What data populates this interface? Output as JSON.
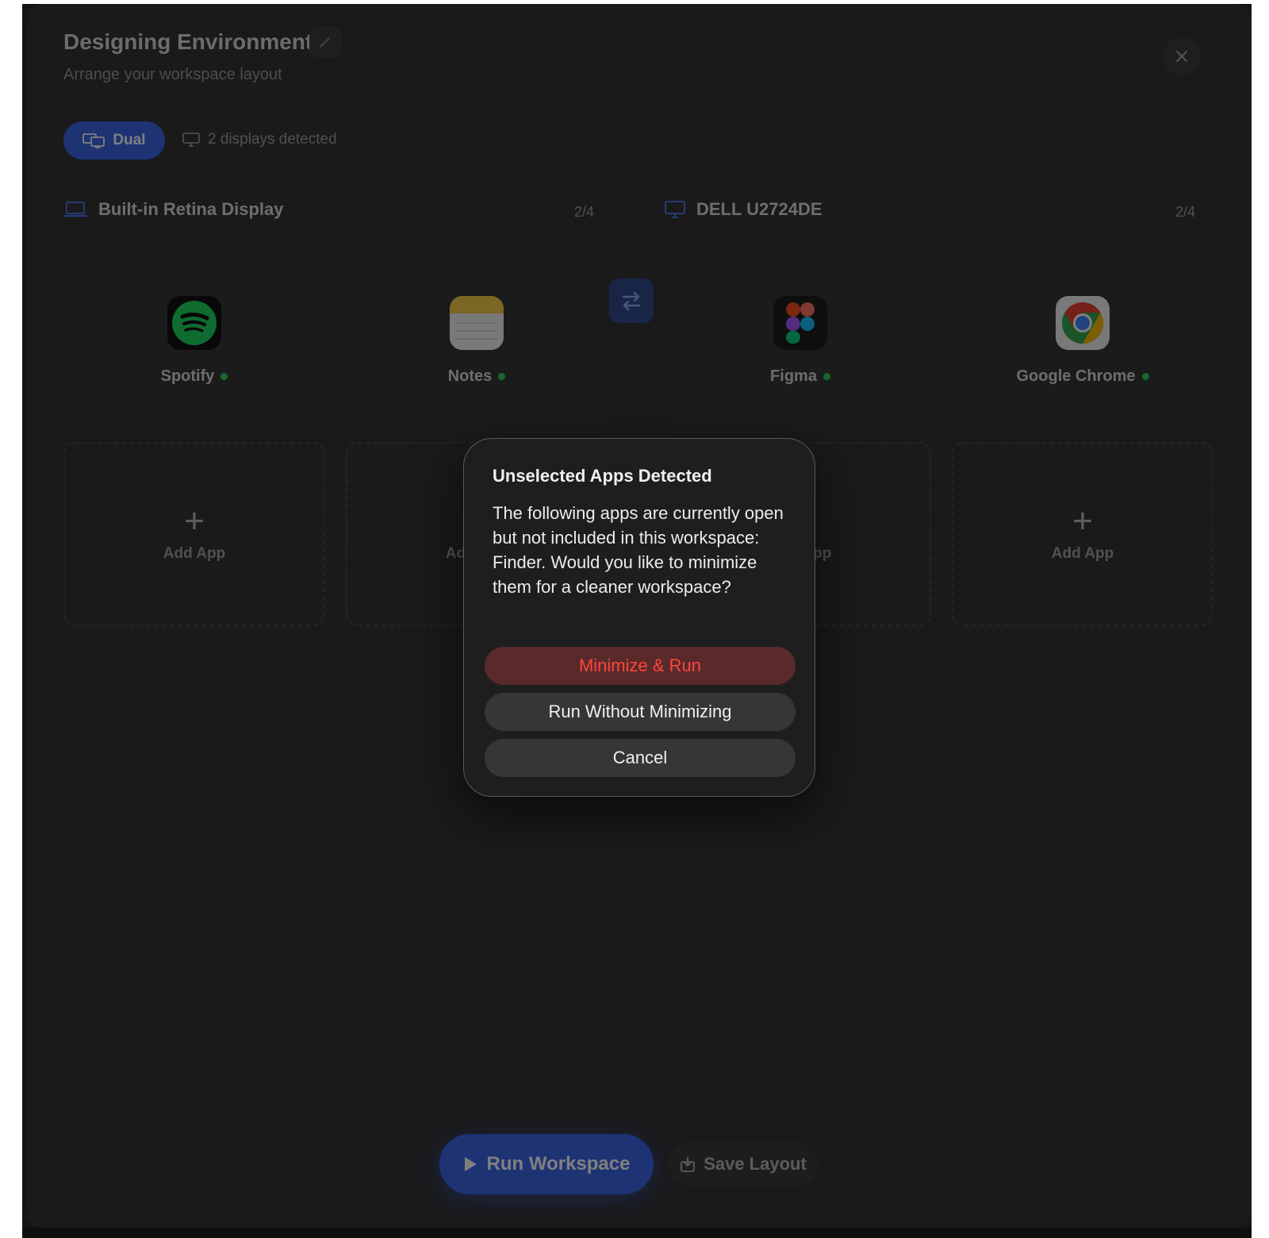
{
  "window": {
    "title": "Designing Environment",
    "subtitle": "Arrange your workspace layout"
  },
  "mode": {
    "selected": "Dual",
    "displays_detected": "2 displays detected"
  },
  "displays": [
    {
      "name": "Built-in Retina Display",
      "count": "2/4",
      "apps": [
        {
          "name": "Spotify",
          "icon": "spotify-icon",
          "running": true
        },
        {
          "name": "Notes",
          "icon": "notes-icon",
          "running": true
        }
      ],
      "add_slots": [
        "Add App",
        "Add App"
      ]
    },
    {
      "name": "DELL U2724DE",
      "count": "2/4",
      "apps": [
        {
          "name": "Figma",
          "icon": "figma-icon",
          "running": true
        },
        {
          "name": "Google Chrome",
          "icon": "chrome-icon",
          "running": true
        }
      ],
      "add_slots": [
        "Add App",
        "Add App"
      ]
    }
  ],
  "footer": {
    "run_label": "Run Workspace",
    "save_label": "Save Layout"
  },
  "dialog": {
    "title": "Unselected Apps Detected",
    "message": "The following apps are currently open but not included in this workspace: Finder. Would you like to minimize them for a cleaner workspace?",
    "primary_label": "Minimize & Run",
    "secondary_label": "Run Without Minimizing",
    "cancel_label": "Cancel"
  },
  "colors": {
    "accent": "#3b66e8",
    "running_dot": "#2fd158",
    "destructive": "#ff453a"
  }
}
